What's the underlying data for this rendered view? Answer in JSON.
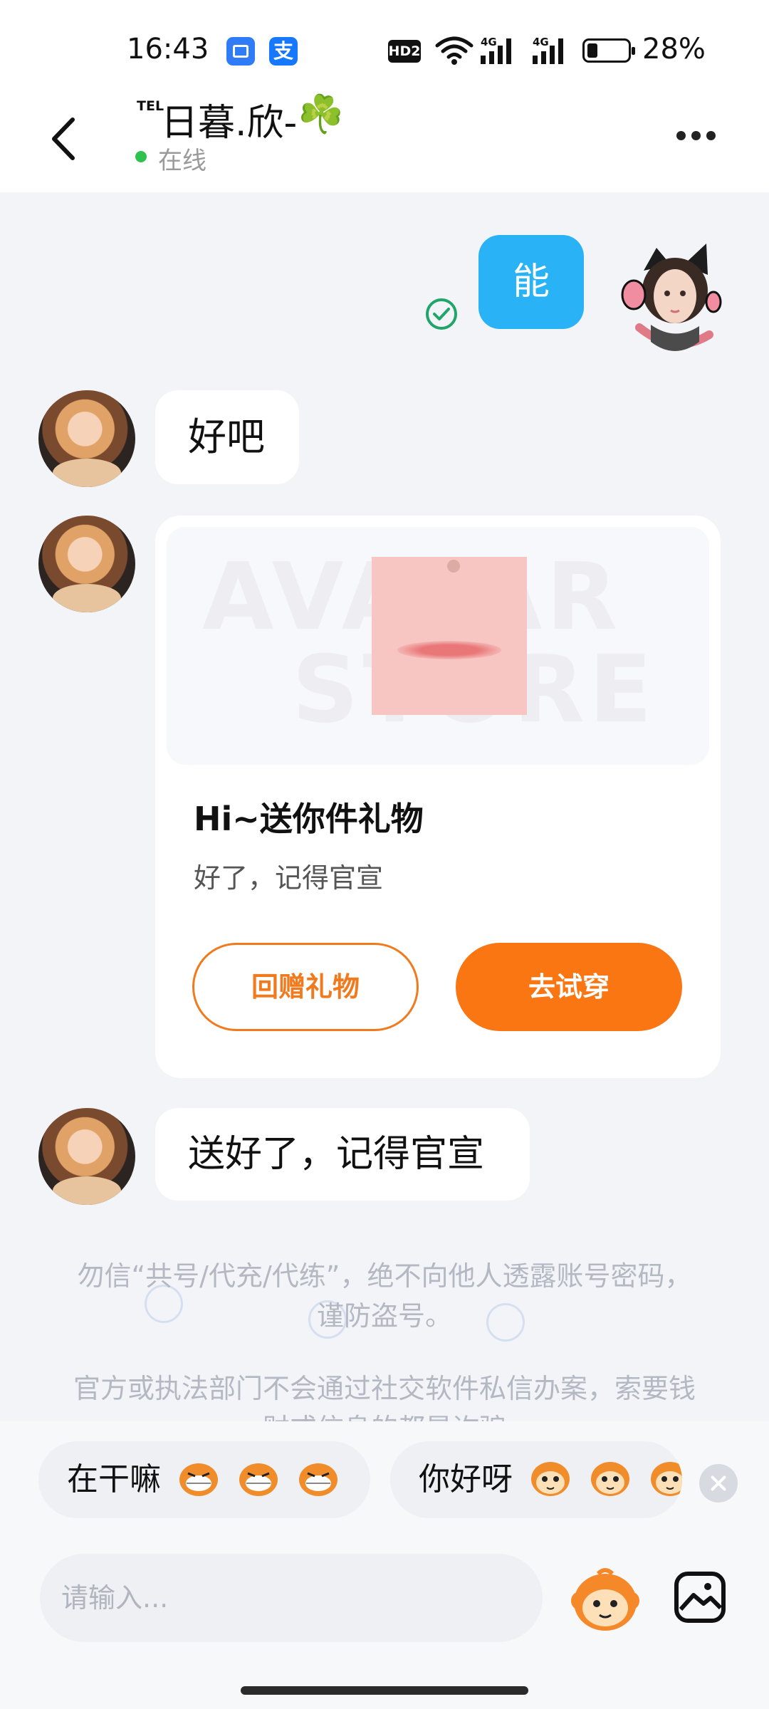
{
  "status_bar": {
    "time": "16:43",
    "hd_label": "HD2",
    "network": "4G",
    "battery": "28%",
    "app_icons": [
      "calendar-app-icon",
      "alipay-icon"
    ]
  },
  "header": {
    "tel_prefix": "TEL",
    "contact_name": "日暮.欣-",
    "name_emoji": "☘️",
    "online_status": "在线"
  },
  "messages": {
    "mine_1": "能",
    "theirs_1": "好吧",
    "gift_card": {
      "watermark_line1": "AVATAR",
      "watermark_line2": "STORE",
      "title": "Hi~送你件礼物",
      "subtitle": "好了，记得官宣",
      "return_gift_label": "回赠礼物",
      "try_on_label": "去试穿"
    },
    "theirs_2": "送好了，记得官宣"
  },
  "notices": {
    "notice_1": "勿信“共号/代充/代练”，绝不向他人透露账号密码，谨防盗号。",
    "notice_2": "官方或执法部门不会通过社交软件私信办案，索要钱财或信息的都是诈骗"
  },
  "quick_replies": [
    {
      "text": "在干嘛"
    },
    {
      "text": "你好呀"
    }
  ],
  "input": {
    "placeholder": "请输入..."
  },
  "colors": {
    "accent_orange": "#fa7612",
    "my_bubble_blue": "#29b2f6",
    "online_green": "#2fc24f",
    "read_check_green": "#21a56b"
  }
}
